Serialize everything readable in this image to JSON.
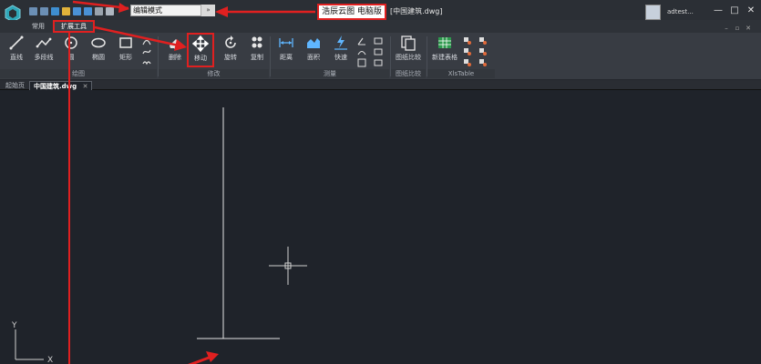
{
  "titlebar": {
    "mode_value": "编辑模式",
    "mode_dropdown": "»",
    "doc_title_highlight": "浩辰云图 电脑版",
    "doc_title_suffix": "[中国建筑.dwg]",
    "user_name": "adtest...",
    "min": "—",
    "max": "□",
    "close": "✕",
    "sub_min": "–",
    "sub_restore": "▫",
    "sub_close": "✕"
  },
  "tabs": [
    "常用",
    "扩展工具"
  ],
  "ribbon": {
    "draw": [
      "直线",
      "多段线",
      "圆",
      "椭圆",
      "矩形"
    ],
    "modify": [
      "删除",
      "移动",
      "旋转",
      "复制"
    ],
    "measure": [
      "距离",
      "面积",
      "快速"
    ],
    "compare": [
      "图纸比较"
    ],
    "table": [
      "新建表格"
    ],
    "groups": [
      "绘图",
      "修改",
      "测量",
      "图纸比较",
      "XlsTable"
    ]
  },
  "doc_tabs": [
    "起始页",
    "中国建筑.dwg"
  ],
  "doc_tab_close": "✕",
  "canvas": {
    "axis_y": "Y",
    "axis_x": "X"
  },
  "colors": {
    "accent_red": "#e02020",
    "bg": "#1f232a",
    "ribbon": "#383c43"
  }
}
